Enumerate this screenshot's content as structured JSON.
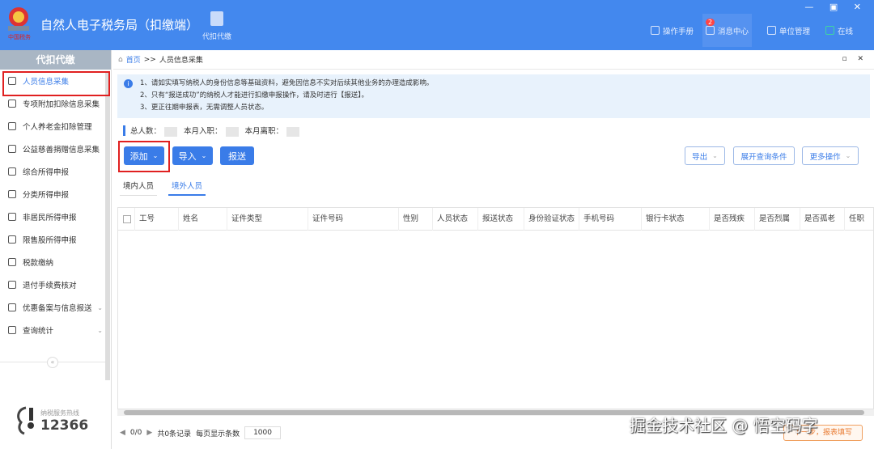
{
  "header": {
    "title": "自然人电子税务局（扣缴端）",
    "module": "代扣代缴",
    "nav": [
      {
        "label": "操作手册"
      },
      {
        "label": "消息中心",
        "badge": "2"
      },
      {
        "label": "单位管理"
      },
      {
        "label": "在线"
      }
    ],
    "window_controls": "— ▣ ✕"
  },
  "sidebar": {
    "title": "代扣代缴",
    "items": [
      {
        "label": "人员信息采集"
      },
      {
        "label": "专项附加扣除信息采集"
      },
      {
        "label": "个人养老金扣除管理"
      },
      {
        "label": "公益慈善捐赠信息采集"
      },
      {
        "label": "综合所得申报"
      },
      {
        "label": "分类所得申报"
      },
      {
        "label": "非居民所得申报"
      },
      {
        "label": "限售股所得申报"
      },
      {
        "label": "税款缴纳"
      },
      {
        "label": "退付手续费核对"
      },
      {
        "label": "优惠备案与信息报送"
      },
      {
        "label": "查询统计"
      }
    ],
    "collapse": "«",
    "hotline_label": "纳税服务热线",
    "hotline": "12366"
  },
  "breadcrumb": {
    "home": "首页",
    "sep": ">>",
    "current": "人员信息采集",
    "controls": "▫ ✕"
  },
  "notice": [
    "1、请如实填写纳税人的身份信息等基础资料，避免因信息不实对后续其他业务的办理造成影响。",
    "2、只有“报送成功”的纳税人才能进行扣缴申报操作，请及时进行【报送】。",
    "3、更正往期申报表，无需调整人员状态。"
  ],
  "stats": {
    "total": "总人数：",
    "joined": "本月入职：",
    "left": "本月离职："
  },
  "toolbar": {
    "add": "添加",
    "import": "导入",
    "submit": "报送",
    "export": "导出",
    "expand": "展开查询条件",
    "more": "更多操作"
  },
  "tabs": [
    "境内人员",
    "境外人员"
  ],
  "table": {
    "columns": [
      "工号",
      "姓名",
      "证件类型",
      "证件号码",
      "性别",
      "人员状态",
      "报送状态",
      "身份验证状态",
      "手机号码",
      "银行卡状态",
      "是否残疾",
      "是否烈属",
      "是否孤老",
      "任职"
    ]
  },
  "pager": {
    "pages": "0/0",
    "total": "共0条记录",
    "per_page_label": "每页显示条数",
    "per_page": "1000"
  },
  "next_button": "下一步，报表填写",
  "watermark": "掘金技术社区 @ 悟空码字"
}
